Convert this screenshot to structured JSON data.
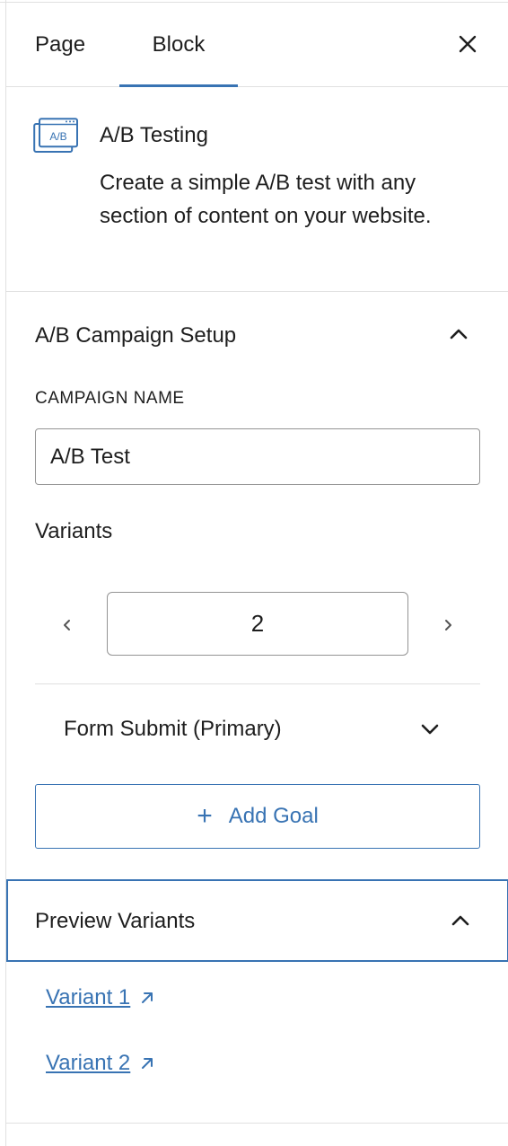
{
  "tabs": {
    "page": "Page",
    "block": "Block"
  },
  "block": {
    "icon_text": "A/B",
    "title": "A/B Testing",
    "description": "Create a simple A/B test with any section of content on your website."
  },
  "campaign": {
    "section_title": "A/B Campaign Setup",
    "name_label": "CAMPAIGN NAME",
    "name_value": "A/B Test",
    "variants_label": "Variants",
    "variants_count": "2",
    "goal": "Form Submit (Primary)",
    "add_goal": "Add Goal"
  },
  "preview": {
    "section_title": "Preview Variants",
    "links": [
      "Variant 1",
      "Variant 2"
    ]
  },
  "colors": {
    "accent": "#3873b3",
    "border": "#e0e0e0",
    "text": "#1e1e1e"
  }
}
